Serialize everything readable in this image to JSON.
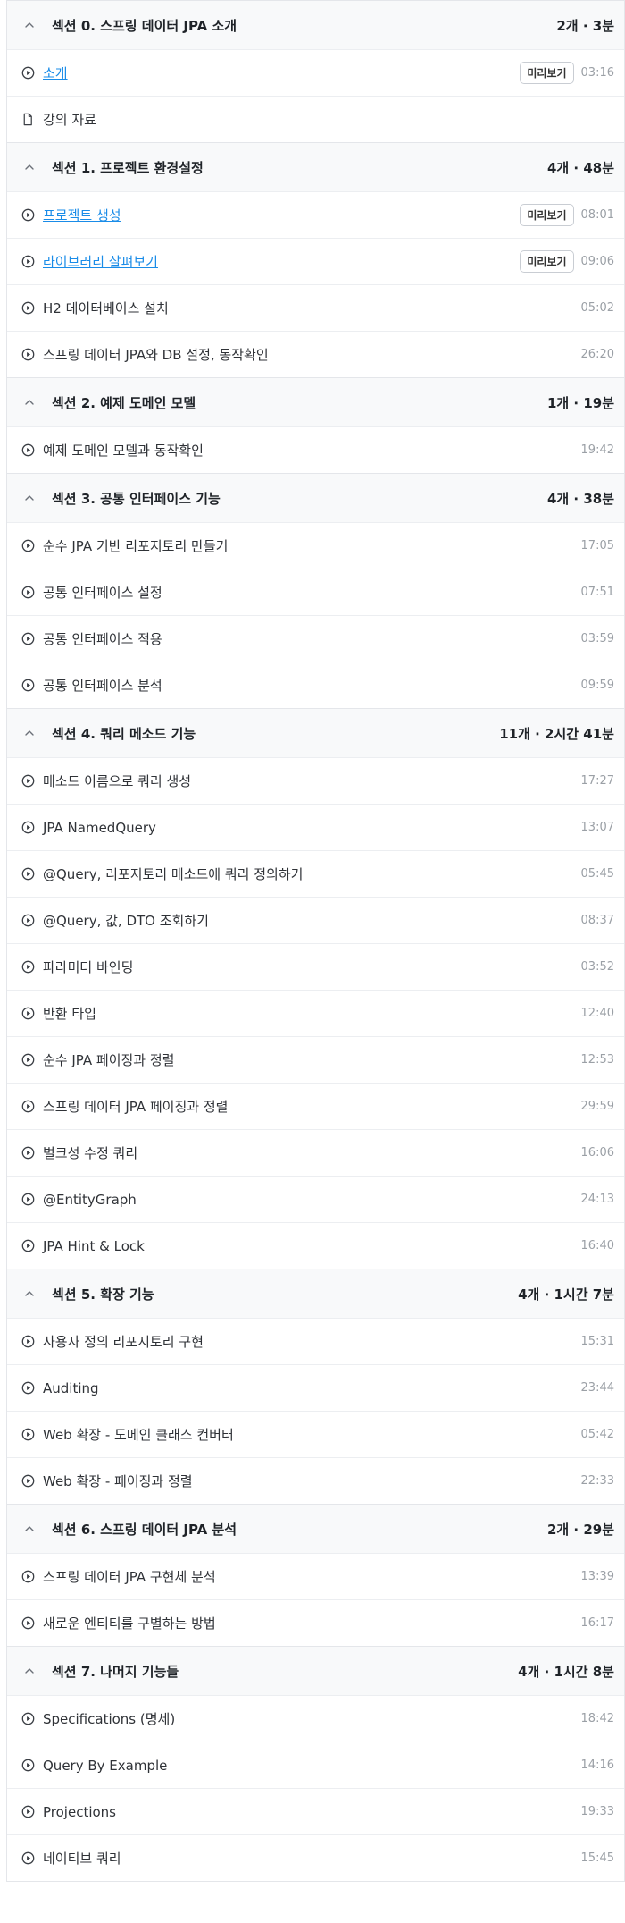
{
  "colors": {
    "link": "#1a8ce8",
    "header_bg": "#f8f9fa",
    "border": "#e4e6ea",
    "time": "#9ba0a6"
  },
  "sections": [
    {
      "title": "섹션 0. 스프링 데이터 JPA 소개",
      "meta": "2개 ∙ 3분",
      "lectures": [
        {
          "title": "소개",
          "time": "03:16",
          "preview": "미리보기",
          "icon": "play-icon"
        },
        {
          "title": "강의 자료",
          "time": "",
          "icon": "file-icon"
        }
      ]
    },
    {
      "title": "섹션 1. 프로젝트 환경설정",
      "meta": "4개 ∙ 48분",
      "lectures": [
        {
          "title": "프로젝트 생성",
          "time": "08:01",
          "preview": "미리보기",
          "icon": "play-icon"
        },
        {
          "title": "라이브러리 살펴보기",
          "time": "09:06",
          "preview": "미리보기",
          "icon": "play-icon"
        },
        {
          "title": "H2 데이터베이스 설치",
          "time": "05:02",
          "icon": "play-icon"
        },
        {
          "title": "스프링 데이터 JPA와 DB 설정, 동작확인",
          "time": "26:20",
          "icon": "play-icon"
        }
      ]
    },
    {
      "title": "섹션 2. 예제 도메인 모델",
      "meta": "1개 ∙ 19분",
      "lectures": [
        {
          "title": "예제 도메인 모델과 동작확인",
          "time": "19:42",
          "icon": "play-icon"
        }
      ]
    },
    {
      "title": "섹션 3. 공통 인터페이스 기능",
      "meta": "4개 ∙ 38분",
      "lectures": [
        {
          "title": "순수 JPA 기반 리포지토리 만들기",
          "time": "17:05",
          "icon": "play-icon"
        },
        {
          "title": "공통 인터페이스 설정",
          "time": "07:51",
          "icon": "play-icon"
        },
        {
          "title": "공통 인터페이스 적용",
          "time": "03:59",
          "icon": "play-icon"
        },
        {
          "title": "공통 인터페이스 분석",
          "time": "09:59",
          "icon": "play-icon"
        }
      ]
    },
    {
      "title": "섹션 4. 쿼리 메소드 기능",
      "meta": "11개 ∙ 2시간 41분",
      "lectures": [
        {
          "title": "메소드 이름으로 쿼리 생성",
          "time": "17:27",
          "icon": "play-icon"
        },
        {
          "title": "JPA NamedQuery",
          "time": "13:07",
          "icon": "play-icon"
        },
        {
          "title": "@Query, 리포지토리 메소드에 쿼리 정의하기",
          "time": "05:45",
          "icon": "play-icon"
        },
        {
          "title": "@Query, 값, DTO 조회하기",
          "time": "08:37",
          "icon": "play-icon"
        },
        {
          "title": "파라미터 바인딩",
          "time": "03:52",
          "icon": "play-icon"
        },
        {
          "title": "반환 타입",
          "time": "12:40",
          "icon": "play-icon"
        },
        {
          "title": "순수 JPA 페이징과 정렬",
          "time": "12:53",
          "icon": "play-icon"
        },
        {
          "title": "스프링 데이터 JPA 페이징과 정렬",
          "time": "29:59",
          "icon": "play-icon"
        },
        {
          "title": "벌크성 수정 쿼리",
          "time": "16:06",
          "icon": "play-icon"
        },
        {
          "title": "@EntityGraph",
          "time": "24:13",
          "icon": "play-icon"
        },
        {
          "title": "JPA Hint & Lock",
          "time": "16:40",
          "icon": "play-icon"
        }
      ]
    },
    {
      "title": "섹션 5. 확장 기능",
      "meta": "4개 ∙ 1시간 7분",
      "lectures": [
        {
          "title": "사용자 정의 리포지토리 구현",
          "time": "15:31",
          "icon": "play-icon"
        },
        {
          "title": "Auditing",
          "time": "23:44",
          "icon": "play-icon"
        },
        {
          "title": "Web 확장 - 도메인 클래스 컨버터",
          "time": "05:42",
          "icon": "play-icon"
        },
        {
          "title": "Web 확장 - 페이징과 정렬",
          "time": "22:33",
          "icon": "play-icon"
        }
      ]
    },
    {
      "title": "섹션 6. 스프링 데이터 JPA 분석",
      "meta": "2개 ∙ 29분",
      "lectures": [
        {
          "title": "스프링 데이터 JPA 구현체 분석",
          "time": "13:39",
          "icon": "play-icon"
        },
        {
          "title": "새로운 엔티티를 구별하는 방법",
          "time": "16:17",
          "icon": "play-icon"
        }
      ]
    },
    {
      "title": "섹션 7. 나머지 기능들",
      "meta": "4개 ∙ 1시간 8분",
      "lectures": [
        {
          "title": "Specifications (명세)",
          "time": "18:42",
          "icon": "play-icon"
        },
        {
          "title": "Query By Example",
          "time": "14:16",
          "icon": "play-icon"
        },
        {
          "title": "Projections",
          "time": "19:33",
          "icon": "play-icon"
        },
        {
          "title": "네이티브 쿼리",
          "time": "15:45",
          "icon": "play-icon"
        }
      ]
    }
  ]
}
